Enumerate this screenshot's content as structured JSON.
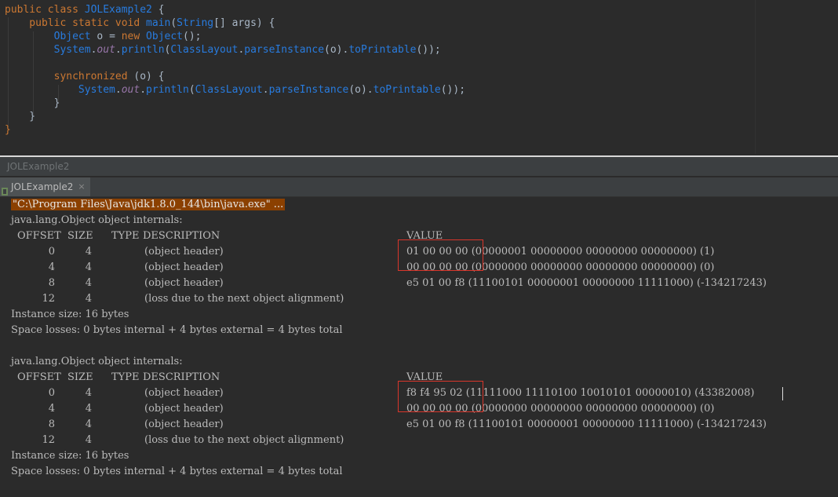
{
  "editor": {
    "lines": [
      {
        "parts": [
          [
            "kw",
            "public class "
          ],
          [
            "cls",
            "JOLExample2"
          ],
          [
            "plain",
            " {"
          ]
        ]
      },
      {
        "parts": [
          [
            "kw",
            "    public static void "
          ],
          [
            "cls",
            "main"
          ],
          [
            "plain",
            "("
          ],
          [
            "cls",
            "String"
          ],
          [
            "plain",
            "[] args) {"
          ]
        ]
      },
      {
        "parts": [
          [
            "plain",
            "        "
          ],
          [
            "cls",
            "Object"
          ],
          [
            "plain",
            " o = "
          ],
          [
            "kw",
            "new "
          ],
          [
            "cls",
            "Object"
          ],
          [
            "plain",
            "();"
          ]
        ]
      },
      {
        "parts": [
          [
            "plain",
            "        "
          ],
          [
            "cls",
            "System"
          ],
          [
            "plain",
            "."
          ],
          [
            "fld",
            "out"
          ],
          [
            "plain",
            "."
          ],
          [
            "cls",
            "println"
          ],
          [
            "plain",
            "("
          ],
          [
            "cls",
            "ClassLayout"
          ],
          [
            "plain",
            "."
          ],
          [
            "cls",
            "parseInstance"
          ],
          [
            "plain",
            "(o)."
          ],
          [
            "cls",
            "toPrintable"
          ],
          [
            "plain",
            "());"
          ]
        ]
      },
      {
        "parts": [
          [
            "plain",
            ""
          ]
        ]
      },
      {
        "parts": [
          [
            "plain",
            "        "
          ],
          [
            "kw",
            "synchronized "
          ],
          [
            "plain",
            "(o) {"
          ]
        ]
      },
      {
        "parts": [
          [
            "plain",
            "            "
          ],
          [
            "cls",
            "System"
          ],
          [
            "plain",
            "."
          ],
          [
            "fld",
            "out"
          ],
          [
            "plain",
            "."
          ],
          [
            "cls",
            "println"
          ],
          [
            "plain",
            "("
          ],
          [
            "cls",
            "ClassLayout"
          ],
          [
            "plain",
            "."
          ],
          [
            "cls",
            "parseInstance"
          ],
          [
            "plain",
            "(o)."
          ],
          [
            "cls",
            "toPrintable"
          ],
          [
            "plain",
            "());"
          ]
        ]
      },
      {
        "parts": [
          [
            "plain",
            "        }"
          ]
        ]
      },
      {
        "parts": [
          [
            "plain",
            "    }"
          ]
        ]
      },
      {
        "parts": [
          [
            "kw",
            "}"
          ]
        ]
      }
    ]
  },
  "run_title": "JOLExample2",
  "tab": {
    "label": "JOLExample2",
    "close": "×"
  },
  "console": {
    "command": "\"C:\\Program Files\\Java\\jdk1.8.0_144\\bin\\java.exe\" ...",
    "blocks": [
      {
        "title": "java.lang.Object object internals:",
        "header": {
          "offset": "OFFSET",
          "size": "SIZE",
          "type": "TYPE",
          "description": "DESCRIPTION",
          "value": "VALUE"
        },
        "rows": [
          {
            "offset": "0",
            "size": "4",
            "description": "(object header)",
            "value": "01 00 00 00 (00000001 00000000 00000000 00000000) (1)"
          },
          {
            "offset": "4",
            "size": "4",
            "description": "(object header)",
            "value": "00 00 00 00 (00000000 00000000 00000000 00000000) (0)"
          },
          {
            "offset": "8",
            "size": "4",
            "description": "(object header)",
            "value": "e5 01 00 f8 (11100101 00000001 00000000 11111000) (-134217243)"
          },
          {
            "offset": "12",
            "size": "4",
            "description": "(loss due to the next object alignment)",
            "value": ""
          }
        ],
        "instance_size": "Instance size: 16 bytes",
        "space_losses": "Space losses: 0 bytes internal + 4 bytes external = 4 bytes total"
      },
      {
        "title": "java.lang.Object object internals:",
        "header": {
          "offset": "OFFSET",
          "size": "SIZE",
          "type": "TYPE",
          "description": "DESCRIPTION",
          "value": "VALUE"
        },
        "rows": [
          {
            "offset": "0",
            "size": "4",
            "description": "(object header)",
            "value": "f8 f4 95 02 (11111000 11110100 10010101 00000010) (43382008)"
          },
          {
            "offset": "4",
            "size": "4",
            "description": "(object header)",
            "value": "00 00 00 00 (00000000 00000000 00000000 00000000) (0)"
          },
          {
            "offset": "8",
            "size": "4",
            "description": "(object header)",
            "value": "e5 01 00 f8 (11100101 00000001 00000000 11111000) (-134217243)"
          },
          {
            "offset": "12",
            "size": "4",
            "description": "(loss due to the next object alignment)",
            "value": ""
          }
        ],
        "instance_size": "Instance size: 16 bytes",
        "space_losses": "Space losses: 0 bytes internal + 4 bytes external = 4 bytes total"
      }
    ]
  },
  "colors": {
    "highlight_box": "#d9362b",
    "command_bg": "#8b4000"
  }
}
